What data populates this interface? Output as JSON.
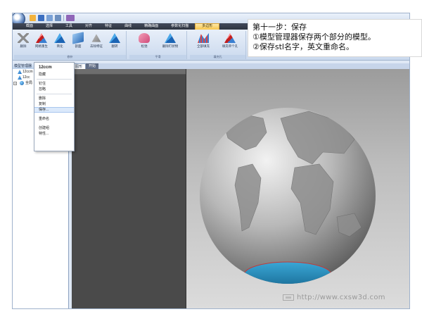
{
  "ribbon_tabs": [
    "截面",
    "选择",
    "工具",
    "对齐",
    "特征",
    "曲线",
    "精确曲面",
    "参数化扫描",
    "多边形"
  ],
  "ribbon_active_tab_index": 8,
  "ribbon": {
    "group1": {
      "label": "修补",
      "buttons": [
        "删除",
        "网格重生",
        "简化",
        "剖面",
        "去除特征",
        "翻转"
      ]
    },
    "group2": {
      "label": "平滑",
      "buttons": [
        "松弛",
        "删除钉状物"
      ]
    },
    "group3": {
      "label": "填充孔",
      "buttons": [
        "全部填充",
        "填充单个孔"
      ]
    }
  },
  "annotation": {
    "line1": "第十一步：保存",
    "line2": "①模型管理器保存两个部分的模型。",
    "line3": "②保存stl名字，英文重命名。"
  },
  "model_manager": {
    "title": "模型管理器",
    "controls": "▾ ⊥ ×",
    "items": [
      "12ccm",
      "12cc",
      "全局"
    ]
  },
  "context_menu": {
    "header": "12ccm",
    "items": [
      "隐藏",
      "钉住",
      "忽略",
      "删除",
      "复制",
      "保存...",
      "重命名",
      "创建组",
      "特性..."
    ],
    "highlighted": "保存..."
  },
  "doc_tabs": [
    "图形",
    "开始"
  ],
  "watermark": "http://www.cxsw3d.com",
  "colors": {
    "active_tab": "#f7c54b",
    "ribbon_bg": "#d4e0f0",
    "viewport_top": "#9c9c9c",
    "viewport_bottom": "#dcdcdc",
    "selection_blue": "#2a8fc0"
  },
  "icons": [
    "app-orb-icon",
    "save-icon",
    "undo-icon",
    "redo-icon",
    "globe-icon",
    "model-icon"
  ]
}
